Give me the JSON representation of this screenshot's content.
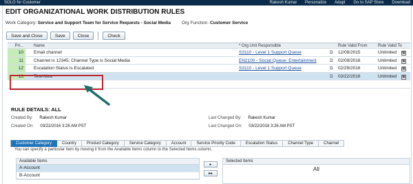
{
  "topbar": {
    "app": "SOLO for Customer",
    "user": "Rakesh Kumar",
    "personalize": "Personalize",
    "adapt": "Adapt",
    "goto": "Go to SAP Store",
    "download": "Download"
  },
  "page": {
    "title": "EDIT ORGANIZATIONAL WORK DISTRIBUTION RULES"
  },
  "context": {
    "work_category_label": "Work Category:",
    "work_category_value": "Service and Support Team for Service Requests - Social Media",
    "org_function_label": "Org Function:",
    "org_function_value": "Customer Service"
  },
  "toolbar": {
    "save_and_close": "Save and Close",
    "save": "Save",
    "close": "Close",
    "check": "Check"
  },
  "grid": {
    "columns": {
      "priority": "Pri...",
      "name": "Name",
      "org_unit": "* Org Unit Responsible",
      "valid_from": "Rule Valid From",
      "valid_to": "Rule Valid To"
    },
    "rows": [
      {
        "priority": "10",
        "name": "Email channel",
        "org_unit": "S3110 - Level 1 Support Queue",
        "valid_from": "12/08/2015",
        "valid_to": "Unlimited"
      },
      {
        "priority": "11",
        "name": "Channel is 12345; Channel Type is Social Media",
        "org_unit": "EN2100 - Social Queue- Entertainment",
        "valid_from": "02/09/2016",
        "valid_to": "Unlimited"
      },
      {
        "priority": "12",
        "name": "Escalation Status is Escalated",
        "org_unit": "S3110 - Level 1 Support Queue",
        "valid_from": "02/29/2016",
        "valid_to": "Unlimited"
      },
      {
        "priority": "13",
        "name": "Test-Now",
        "org_unit": "",
        "valid_from": "03/22/2016",
        "valid_to": "Unlimited"
      }
    ]
  },
  "rule_details": {
    "title": "RULE DETAILS: ALL",
    "created_by_label": "Created By:",
    "created_by": "Rakesh Kumar",
    "created_on_label": "Created On:",
    "created_on": "03/22/2016 3:26 AM PST",
    "last_changed_by_label": "Last Changed By:",
    "last_changed_by": "Rakesh Kumar",
    "last_changed_on_label": "Last Changed On:",
    "last_changed_on": "03/22/2016 3:26 AM PST"
  },
  "tabs": [
    "Customer Category",
    "Country",
    "Product Category",
    "Service Category",
    "Account",
    "Service Priority Code",
    "Escalation Status",
    "Channel Type",
    "Channel"
  ],
  "help_text": "You can specify a particular item by moving it from the Available Items column to the Selected Items column.",
  "available": {
    "header": "Available Items",
    "items": [
      "A-Account",
      "B-Account"
    ]
  },
  "selected": {
    "header": "Selected Items",
    "value": "All"
  },
  "colors": {
    "accent": "#1f72b8",
    "priority_fill": "#c6ecb9",
    "selection": "#cfe2f0",
    "callout": "#c0262d",
    "arrow": "#1d6d6a"
  }
}
